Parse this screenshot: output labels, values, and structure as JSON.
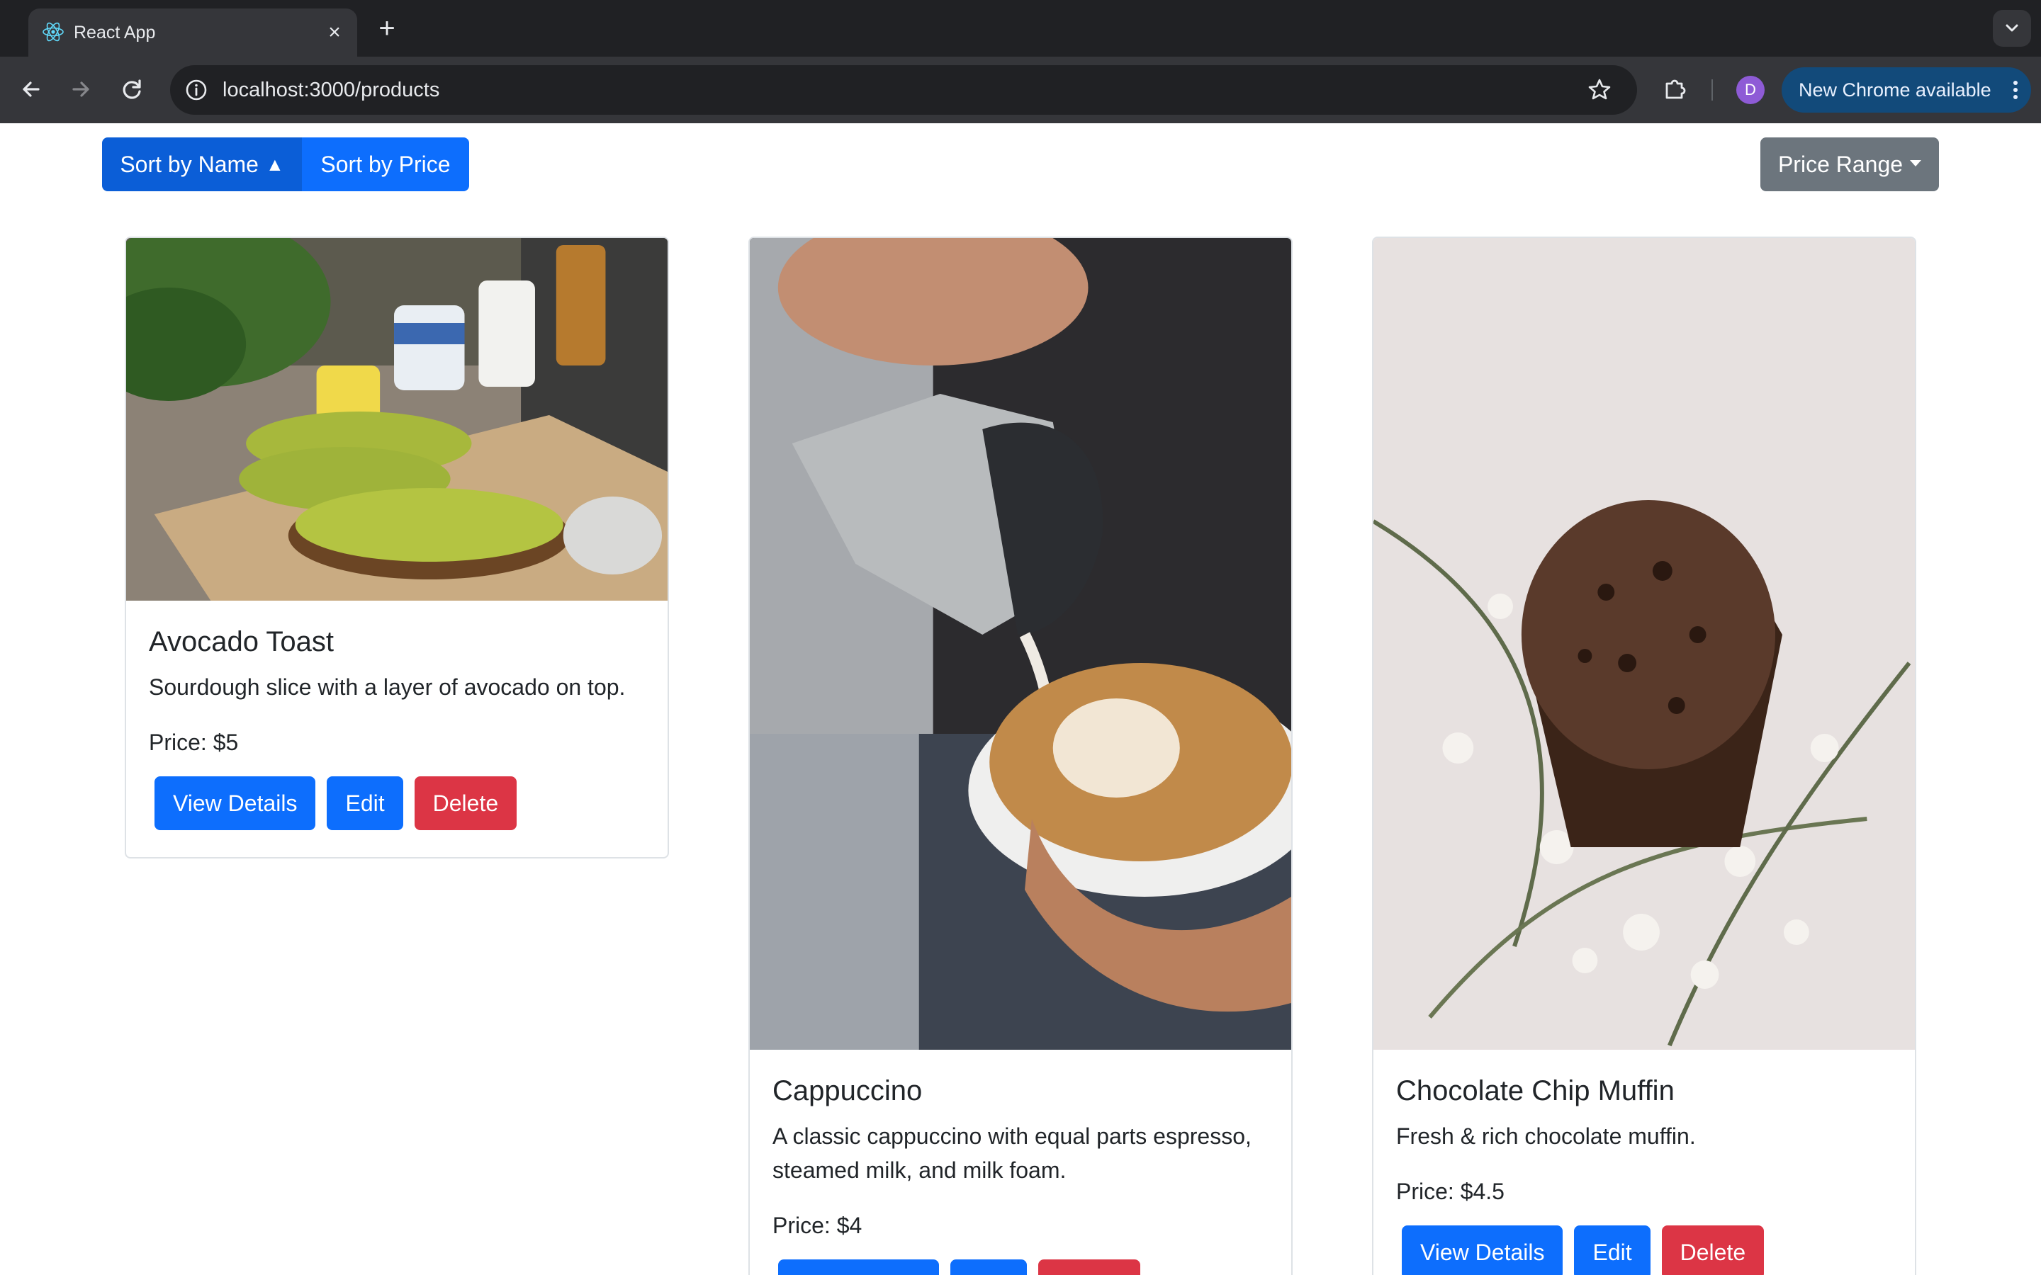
{
  "browser": {
    "tab_title": "React App",
    "tab_icon": "react-logo-icon",
    "url": "localhost:3000/products",
    "profile_initial": "D",
    "update_label": "New Chrome available"
  },
  "controls": {
    "sort_name_label": "Sort by Name",
    "sort_name_indicator": "▲",
    "sort_price_label": "Sort by Price",
    "price_range_label": "Price Range"
  },
  "products": [
    {
      "name": "Avocado Toast",
      "description": "Sourdough slice with a layer of avocado on top.",
      "price": "Price: $5",
      "image": "avocado-toast-photo"
    },
    {
      "name": "Cappuccino",
      "description": "A classic cappuccino with equal parts espresso, steamed milk, and milk foam.",
      "price": "Price: $4",
      "image": "cappuccino-photo"
    },
    {
      "name": "Chocolate Chip Muffin",
      "description": "Fresh & rich chocolate muffin.",
      "price": "Price: $4.5",
      "image": "chocolate-muffin-photo"
    }
  ],
  "actions": {
    "view_label": "View Details",
    "edit_label": "Edit",
    "delete_label": "Delete"
  },
  "colors": {
    "primary": "#0d6efd",
    "primary_active": "#0b5ed7",
    "secondary": "#6c757d",
    "danger": "#dc3545"
  }
}
